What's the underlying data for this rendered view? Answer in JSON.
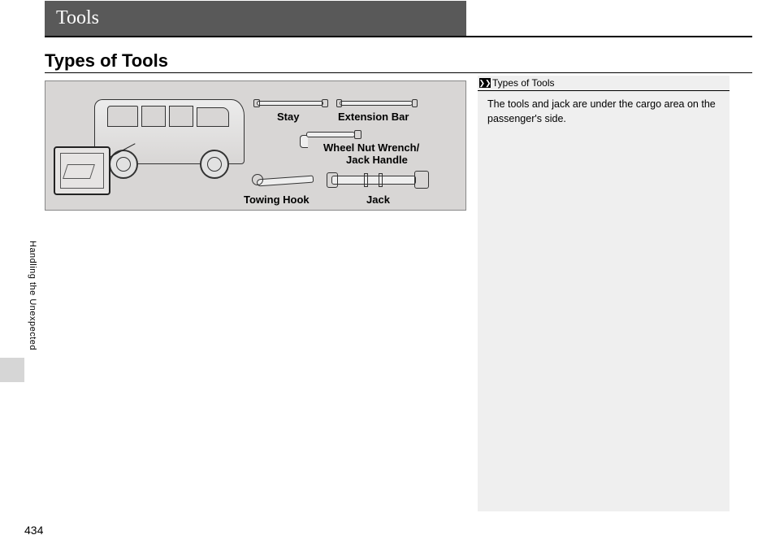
{
  "header": {
    "title": "Tools"
  },
  "section": {
    "title": "Types of Tools"
  },
  "figure": {
    "labels": {
      "stay": "Stay",
      "extension_bar": "Extension Bar",
      "wrench_line1": "Wheel Nut Wrench/",
      "wrench_line2": "Jack Handle",
      "towing_hook": "Towing Hook",
      "jack": "Jack"
    }
  },
  "sidebar": {
    "marker": "❯❯",
    "header": "Types of Tools",
    "body": "The tools and jack are under the cargo area on the passenger's side."
  },
  "side_tab": "Handling the Unexpected",
  "page_number": "434"
}
